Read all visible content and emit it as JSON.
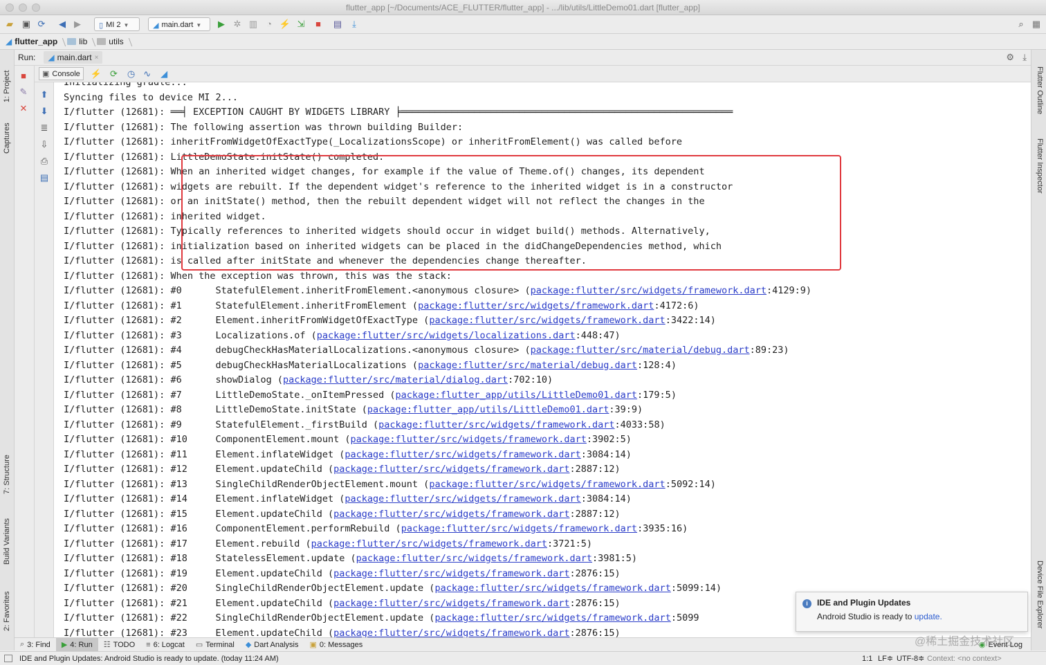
{
  "window": {
    "title": "flutter_app [~/Documents/ACE_FLUTTER/flutter_app] - .../lib/utils/LittleDemo01.dart [flutter_app]"
  },
  "toolbar": {
    "device": "MI 2",
    "run_config": "main.dart"
  },
  "breadcrumbs": [
    "flutter_app",
    "lib",
    "utils"
  ],
  "left_tabs": [
    "1: Project",
    "Captures",
    "7: Structure",
    "Build Variants",
    "2: Favorites"
  ],
  "right_tabs": [
    "Flutter Outline",
    "Flutter Inspector",
    "Device File Explorer"
  ],
  "run": {
    "label": "Run:",
    "tab": "main.dart",
    "console_tab": "Console"
  },
  "console": {
    "lines": [
      {
        "prefix": "",
        "text": "Initializing gradle...",
        "link": "",
        "suffix": ""
      },
      {
        "prefix": "",
        "text": "Syncing files to device MI 2...",
        "link": "",
        "suffix": ""
      },
      {
        "prefix": "I/flutter (12681): ",
        "text": "══╡ EXCEPTION CAUGHT BY WIDGETS LIBRARY ╞═══════════════════════════════════════════════════════════",
        "link": "",
        "suffix": ""
      },
      {
        "prefix": "I/flutter (12681): ",
        "text": "The following assertion was thrown building Builder:",
        "link": "",
        "suffix": ""
      },
      {
        "prefix": "I/flutter (12681): ",
        "text": "inheritFromWidgetOfExactType(_LocalizationsScope) or inheritFromElement() was called before",
        "link": "",
        "suffix": ""
      },
      {
        "prefix": "I/flutter (12681): ",
        "text": "LittleDemoState.initState() completed.",
        "link": "",
        "suffix": ""
      },
      {
        "prefix": "I/flutter (12681): ",
        "text": "When an inherited widget changes, for example if the value of Theme.of() changes, its dependent",
        "link": "",
        "suffix": ""
      },
      {
        "prefix": "I/flutter (12681): ",
        "text": "widgets are rebuilt. If the dependent widget's reference to the inherited widget is in a constructor",
        "link": "",
        "suffix": ""
      },
      {
        "prefix": "I/flutter (12681): ",
        "text": "or an initState() method, then the rebuilt dependent widget will not reflect the changes in the",
        "link": "",
        "suffix": ""
      },
      {
        "prefix": "I/flutter (12681): ",
        "text": "inherited widget.",
        "link": "",
        "suffix": ""
      },
      {
        "prefix": "I/flutter (12681): ",
        "text": "Typically references to inherited widgets should occur in widget build() methods. Alternatively,",
        "link": "",
        "suffix": ""
      },
      {
        "prefix": "I/flutter (12681): ",
        "text": "initialization based on inherited widgets can be placed in the didChangeDependencies method, which",
        "link": "",
        "suffix": ""
      },
      {
        "prefix": "I/flutter (12681): ",
        "text": "is called after initState and whenever the dependencies change thereafter.",
        "link": "",
        "suffix": ""
      },
      {
        "prefix": "I/flutter (12681): ",
        "text": "When the exception was thrown, this was the stack:",
        "link": "",
        "suffix": ""
      },
      {
        "prefix": "I/flutter (12681): ",
        "text": "#0      StatefulElement.inheritFromElement.<anonymous closure> (",
        "link": "package:flutter/src/widgets/framework.dart",
        "suffix": ":4129:9)"
      },
      {
        "prefix": "I/flutter (12681): ",
        "text": "#1      StatefulElement.inheritFromElement (",
        "link": "package:flutter/src/widgets/framework.dart",
        "suffix": ":4172:6)"
      },
      {
        "prefix": "I/flutter (12681): ",
        "text": "#2      Element.inheritFromWidgetOfExactType (",
        "link": "package:flutter/src/widgets/framework.dart",
        "suffix": ":3422:14)"
      },
      {
        "prefix": "I/flutter (12681): ",
        "text": "#3      Localizations.of (",
        "link": "package:flutter/src/widgets/localizations.dart",
        "suffix": ":448:47)"
      },
      {
        "prefix": "I/flutter (12681): ",
        "text": "#4      debugCheckHasMaterialLocalizations.<anonymous closure> (",
        "link": "package:flutter/src/material/debug.dart",
        "suffix": ":89:23)"
      },
      {
        "prefix": "I/flutter (12681): ",
        "text": "#5      debugCheckHasMaterialLocalizations (",
        "link": "package:flutter/src/material/debug.dart",
        "suffix": ":128:4)"
      },
      {
        "prefix": "I/flutter (12681): ",
        "text": "#6      showDialog (",
        "link": "package:flutter/src/material/dialog.dart",
        "suffix": ":702:10)"
      },
      {
        "prefix": "I/flutter (12681): ",
        "text": "#7      LittleDemoState._onItemPressed (",
        "link": "package:flutter_app/utils/LittleDemo01.dart",
        "suffix": ":179:5)"
      },
      {
        "prefix": "I/flutter (12681): ",
        "text": "#8      LittleDemoState.initState (",
        "link": "package:flutter_app/utils/LittleDemo01.dart",
        "suffix": ":39:9)"
      },
      {
        "prefix": "I/flutter (12681): ",
        "text": "#9      StatefulElement._firstBuild (",
        "link": "package:flutter/src/widgets/framework.dart",
        "suffix": ":4033:58)"
      },
      {
        "prefix": "I/flutter (12681): ",
        "text": "#10     ComponentElement.mount (",
        "link": "package:flutter/src/widgets/framework.dart",
        "suffix": ":3902:5)"
      },
      {
        "prefix": "I/flutter (12681): ",
        "text": "#11     Element.inflateWidget (",
        "link": "package:flutter/src/widgets/framework.dart",
        "suffix": ":3084:14)"
      },
      {
        "prefix": "I/flutter (12681): ",
        "text": "#12     Element.updateChild (",
        "link": "package:flutter/src/widgets/framework.dart",
        "suffix": ":2887:12)"
      },
      {
        "prefix": "I/flutter (12681): ",
        "text": "#13     SingleChildRenderObjectElement.mount (",
        "link": "package:flutter/src/widgets/framework.dart",
        "suffix": ":5092:14)"
      },
      {
        "prefix": "I/flutter (12681): ",
        "text": "#14     Element.inflateWidget (",
        "link": "package:flutter/src/widgets/framework.dart",
        "suffix": ":3084:14)"
      },
      {
        "prefix": "I/flutter (12681): ",
        "text": "#15     Element.updateChild (",
        "link": "package:flutter/src/widgets/framework.dart",
        "suffix": ":2887:12)"
      },
      {
        "prefix": "I/flutter (12681): ",
        "text": "#16     ComponentElement.performRebuild (",
        "link": "package:flutter/src/widgets/framework.dart",
        "suffix": ":3935:16)"
      },
      {
        "prefix": "I/flutter (12681): ",
        "text": "#17     Element.rebuild (",
        "link": "package:flutter/src/widgets/framework.dart",
        "suffix": ":3721:5)"
      },
      {
        "prefix": "I/flutter (12681): ",
        "text": "#18     StatelessElement.update (",
        "link": "package:flutter/src/widgets/framework.dart",
        "suffix": ":3981:5)"
      },
      {
        "prefix": "I/flutter (12681): ",
        "text": "#19     Element.updateChild (",
        "link": "package:flutter/src/widgets/framework.dart",
        "suffix": ":2876:15)"
      },
      {
        "prefix": "I/flutter (12681): ",
        "text": "#20     SingleChildRenderObjectElement.update (",
        "link": "package:flutter/src/widgets/framework.dart",
        "suffix": ":5099:14)"
      },
      {
        "prefix": "I/flutter (12681): ",
        "text": "#21     Element.updateChild (",
        "link": "package:flutter/src/widgets/framework.dart",
        "suffix": ":2876:15)"
      },
      {
        "prefix": "I/flutter (12681): ",
        "text": "#22     SingleChildRenderObjectElement.update (",
        "link": "package:flutter/src/widgets/framework.dart",
        "suffix": ":5099"
      },
      {
        "prefix": "I/flutter (12681): ",
        "text": "#23     Element.updateChild (",
        "link": "package:flutter/src/widgets/framework.dart",
        "suffix": ":2876:15)"
      }
    ]
  },
  "bottom_tabs": [
    "3: Find",
    "4: Run",
    "TODO",
    "6: Logcat",
    "Terminal",
    "Dart Analysis",
    "0: Messages"
  ],
  "event_log": "Event Log",
  "notification": {
    "title": "IDE and Plugin Updates",
    "body": "Android Studio is ready to ",
    "link": "update."
  },
  "status": {
    "message": "IDE and Plugin Updates: Android Studio is ready to update. (today 11:24 AM)",
    "position": "1:1",
    "line_sep": "LF≑",
    "encoding": "UTF-8≑",
    "context": "Context: <no context>"
  },
  "watermark": "@稀土掘金技术社区",
  "colors": {
    "link": "#2a3cc8",
    "highlight_box": "#e0393e",
    "run_green": "#3a9f3a",
    "stop_red": "#d9463d"
  }
}
